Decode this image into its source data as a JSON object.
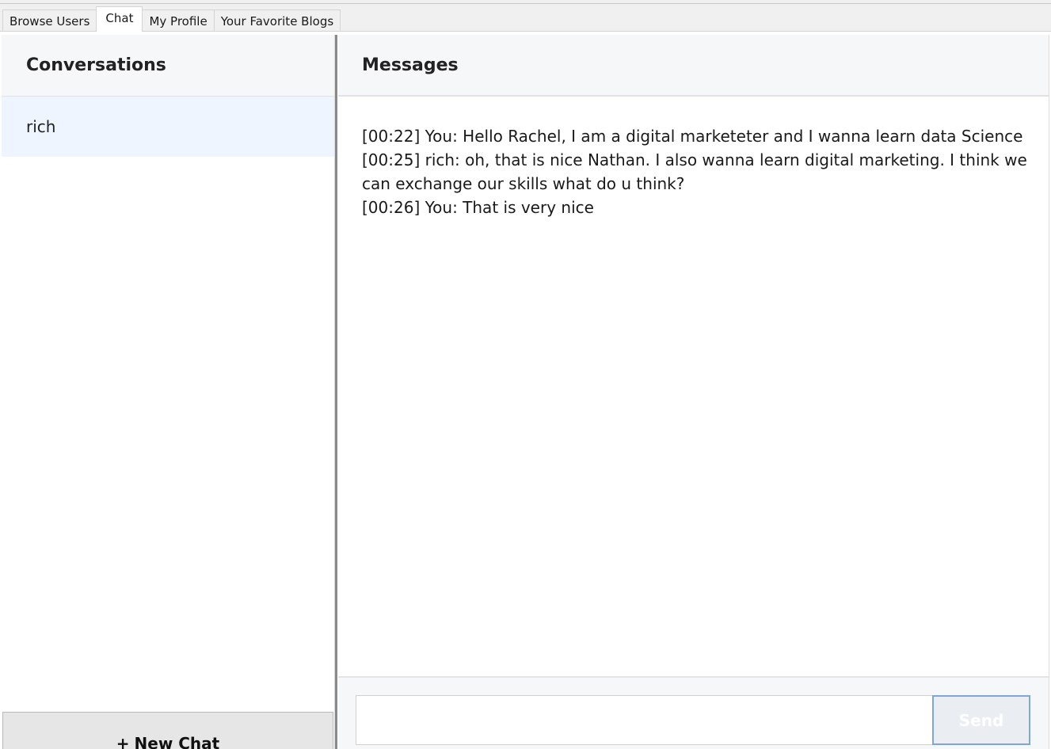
{
  "tabs": [
    {
      "label": "Browse Users",
      "active": false
    },
    {
      "label": "Chat",
      "active": true
    },
    {
      "label": "My Profile",
      "active": false
    },
    {
      "label": "Your Favorite Blogs",
      "active": false
    }
  ],
  "conversations": {
    "title": "Conversations",
    "items": [
      {
        "name": "rich",
        "selected": true
      }
    ],
    "new_chat_label": "New Chat",
    "new_chat_icon": "+"
  },
  "messages_panel": {
    "title": "Messages",
    "lines": [
      "[00:22] You: Hello Rachel, I am a digital marketeter and I wanna learn data Science",
      "[00:25] rich: oh, that is nice Nathan. I also wanna learn digital marketing. I think we can exchange our skills what do u think?",
      "[00:26] You: That is very nice"
    ]
  },
  "compose": {
    "input_value": "",
    "send_label": "Send"
  },
  "colors": {
    "selected_row": "#eef5ff",
    "header_bg": "#f6f7f9",
    "send_border": "#7ea6d6"
  }
}
